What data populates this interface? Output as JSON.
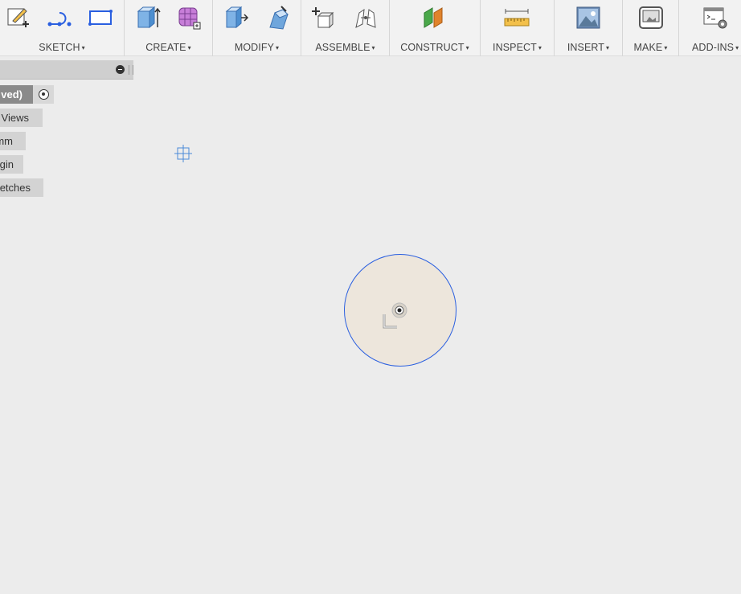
{
  "toolbar": {
    "groups": [
      {
        "id": "sketch",
        "label": "SKETCH",
        "tools": [
          "create-sketch-icon",
          "line-spline-icon",
          "rectangle-icon"
        ]
      },
      {
        "id": "create",
        "label": "CREATE",
        "tools": [
          "box-extrude-icon",
          "form-mesh-icon"
        ]
      },
      {
        "id": "modify",
        "label": "MODIFY",
        "tools": [
          "press-pull-icon",
          "fillet-icon"
        ]
      },
      {
        "id": "assemble",
        "label": "ASSEMBLE",
        "tools": [
          "new-component-icon",
          "joint-icon"
        ]
      },
      {
        "id": "construct",
        "label": "CONSTRUCT",
        "tools": [
          "offset-plane-icon"
        ]
      },
      {
        "id": "inspect",
        "label": "INSPECT",
        "tools": [
          "measure-icon"
        ]
      },
      {
        "id": "insert",
        "label": "INSERT",
        "tools": [
          "insert-image-icon"
        ]
      },
      {
        "id": "make",
        "label": "MAKE",
        "tools": [
          "3d-print-icon"
        ]
      },
      {
        "id": "addins",
        "label": "ADD-INS",
        "tools": [
          "scripts-addins-icon"
        ]
      }
    ],
    "caret": "▾"
  },
  "browser": {
    "root_label": "ved)",
    "items": [
      {
        "label": "Views"
      },
      {
        "label": "mm"
      },
      {
        "label": "gin"
      },
      {
        "label": "etches"
      }
    ]
  },
  "colors": {
    "sketch_stroke": "#2a5fe0",
    "profile_fill": "#ede6dc",
    "accent_orange": "#e0832b",
    "accent_green": "#4aa84a"
  }
}
